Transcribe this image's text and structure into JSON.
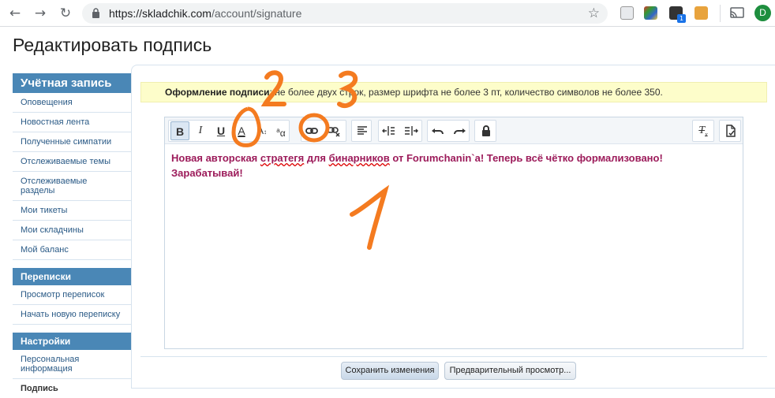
{
  "browser": {
    "url_host": "skladchik.com",
    "url_path": "/account/signature",
    "profile_initial": "D",
    "badge_count": "1"
  },
  "page": {
    "title": "Редактировать подпись"
  },
  "sidebar": {
    "account_header": "Учётная запись",
    "account_items": [
      {
        "label": "Оповещения"
      },
      {
        "label": "Новостная лента"
      },
      {
        "label": "Полученные симпатии"
      },
      {
        "label": "Отслеживаемые темы"
      },
      {
        "label": "Отслеживаемые разделы"
      },
      {
        "label": "Мои тикеты"
      },
      {
        "label": "Мои складчины"
      },
      {
        "label": "Мой баланс"
      }
    ],
    "messages_header": "Переписки",
    "messages_items": [
      {
        "label": "Просмотр переписок"
      },
      {
        "label": "Начать новую переписку"
      }
    ],
    "settings_header": "Настройки",
    "settings_items": [
      {
        "label": "Персональная информация"
      },
      {
        "label": "Подпись"
      }
    ]
  },
  "notice": {
    "bold": "Оформление подписи",
    "text": ": не более двух строк, размер шрифта не более 3 пт, количество символов не более 350."
  },
  "toolbar": {
    "bold": "B",
    "italic": "I",
    "underline": "U",
    "font_color": "A",
    "font_size": "A",
    "font_family": "a",
    "clear_format": "T"
  },
  "editor": {
    "segments": [
      "Новая авторская ",
      "стратегя",
      " для ",
      "бинарников",
      " от Forumchanin`a! Теперь всё чётко формализовано! Зарабатывай!"
    ]
  },
  "buttons": {
    "save": "Сохранить изменения",
    "preview": "Предварительный просмотр..."
  },
  "annotations": {
    "one": "1",
    "two": "2",
    "three": "3"
  },
  "colors": {
    "accent": "#4a87b6",
    "signature_text": "#9c1b5a",
    "annotation": "#f47b20",
    "notice_bg": "#fdfdca"
  }
}
